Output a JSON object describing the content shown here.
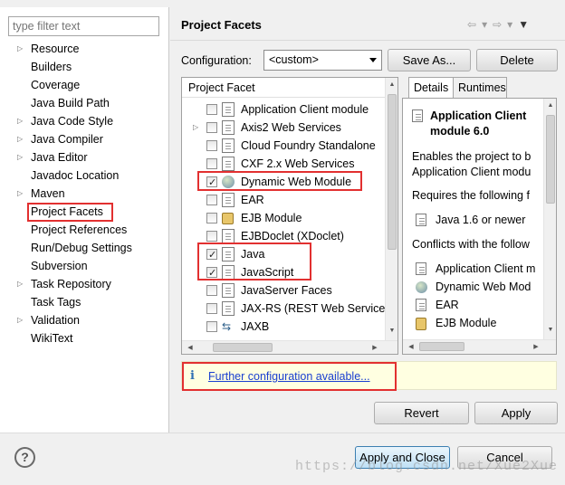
{
  "filter": {
    "placeholder": "type filter text"
  },
  "nav": {
    "items": [
      {
        "label": "Resource",
        "expandable": true
      },
      {
        "label": "Builders",
        "expandable": false
      },
      {
        "label": "Coverage",
        "expandable": false
      },
      {
        "label": "Java Build Path",
        "expandable": false
      },
      {
        "label": "Java Code Style",
        "expandable": true
      },
      {
        "label": "Java Compiler",
        "expandable": true
      },
      {
        "label": "Java Editor",
        "expandable": true
      },
      {
        "label": "Javadoc Location",
        "expandable": false
      },
      {
        "label": "Maven",
        "expandable": true
      },
      {
        "label": "Project Facets",
        "expandable": false,
        "selected": true
      },
      {
        "label": "Project References",
        "expandable": false
      },
      {
        "label": "Run/Debug Settings",
        "expandable": false
      },
      {
        "label": "Subversion",
        "expandable": false
      },
      {
        "label": "Task Repository",
        "expandable": true
      },
      {
        "label": "Task Tags",
        "expandable": false
      },
      {
        "label": "Validation",
        "expandable": true
      },
      {
        "label": "WikiText",
        "expandable": false
      }
    ]
  },
  "page": {
    "title": "Project Facets"
  },
  "toolbar": {
    "back_icon": "back-arrow-icon",
    "forward_icon": "forward-arrow-icon",
    "menu_icon": "view-menu-icon"
  },
  "configuration": {
    "label": "Configuration:",
    "value": "<custom>",
    "save_as": "Save As...",
    "delete": "Delete"
  },
  "facets": {
    "header": "Project Facet",
    "rows": [
      {
        "label": "Application Client module",
        "checked": false,
        "icon": "document-icon",
        "expandable": false
      },
      {
        "label": "Axis2 Web Services",
        "checked": false,
        "icon": "document-icon",
        "expandable": true
      },
      {
        "label": "Cloud Foundry Standalone",
        "checked": false,
        "icon": "document-icon",
        "expandable": false
      },
      {
        "label": "CXF 2.x Web Services",
        "checked": false,
        "icon": "document-icon",
        "expandable": false
      },
      {
        "label": "Dynamic Web Module",
        "checked": true,
        "icon": "globe-icon",
        "expandable": false
      },
      {
        "label": "EAR",
        "checked": false,
        "icon": "document-icon",
        "expandable": false
      },
      {
        "label": "EJB Module",
        "checked": false,
        "icon": "ejb-icon",
        "expandable": false
      },
      {
        "label": "EJBDoclet (XDoclet)",
        "checked": false,
        "icon": "document-icon",
        "expandable": false
      },
      {
        "label": "Java",
        "checked": true,
        "icon": "java-icon",
        "expandable": false
      },
      {
        "label": "JavaScript",
        "checked": true,
        "icon": "document-icon",
        "expandable": false
      },
      {
        "label": "JavaServer Faces",
        "checked": false,
        "icon": "document-icon",
        "expandable": false
      },
      {
        "label": "JAX-RS (REST Web Services)",
        "checked": false,
        "icon": "document-icon",
        "expandable": false
      },
      {
        "label": "JAXB",
        "checked": false,
        "icon": "jaxb-icon",
        "expandable": false
      }
    ]
  },
  "details": {
    "tabs": [
      "Details",
      "Runtimes"
    ],
    "title": "Application Client module 6.0",
    "description": "Enables the project to b",
    "description2": "Application Client modu",
    "requires_label": "Requires the following f",
    "requires": [
      {
        "label": "Java 1.6 or newer",
        "icon": "java-icon"
      }
    ],
    "conflicts_label": "Conflicts with the follow",
    "conflicts": [
      {
        "label": "Application Client m",
        "icon": "document-icon"
      },
      {
        "label": "Dynamic Web Mod",
        "icon": "globe-icon"
      },
      {
        "label": "EAR",
        "icon": "document-icon"
      },
      {
        "label": "EJB Module",
        "icon": "ejb-icon"
      }
    ]
  },
  "info": {
    "icon": "info-icon",
    "link": "Further configuration available..."
  },
  "actions": {
    "revert": "Revert",
    "apply": "Apply",
    "apply_close": "Apply and Close",
    "cancel": "Cancel"
  },
  "help": {
    "icon": "help-icon",
    "glyph": "?"
  },
  "watermark": "https://blog.csdn.net/Xue2Xue",
  "colors": {
    "highlight": "#e23030",
    "link": "#1a3fd0",
    "info_bg": "#ffffe1"
  }
}
